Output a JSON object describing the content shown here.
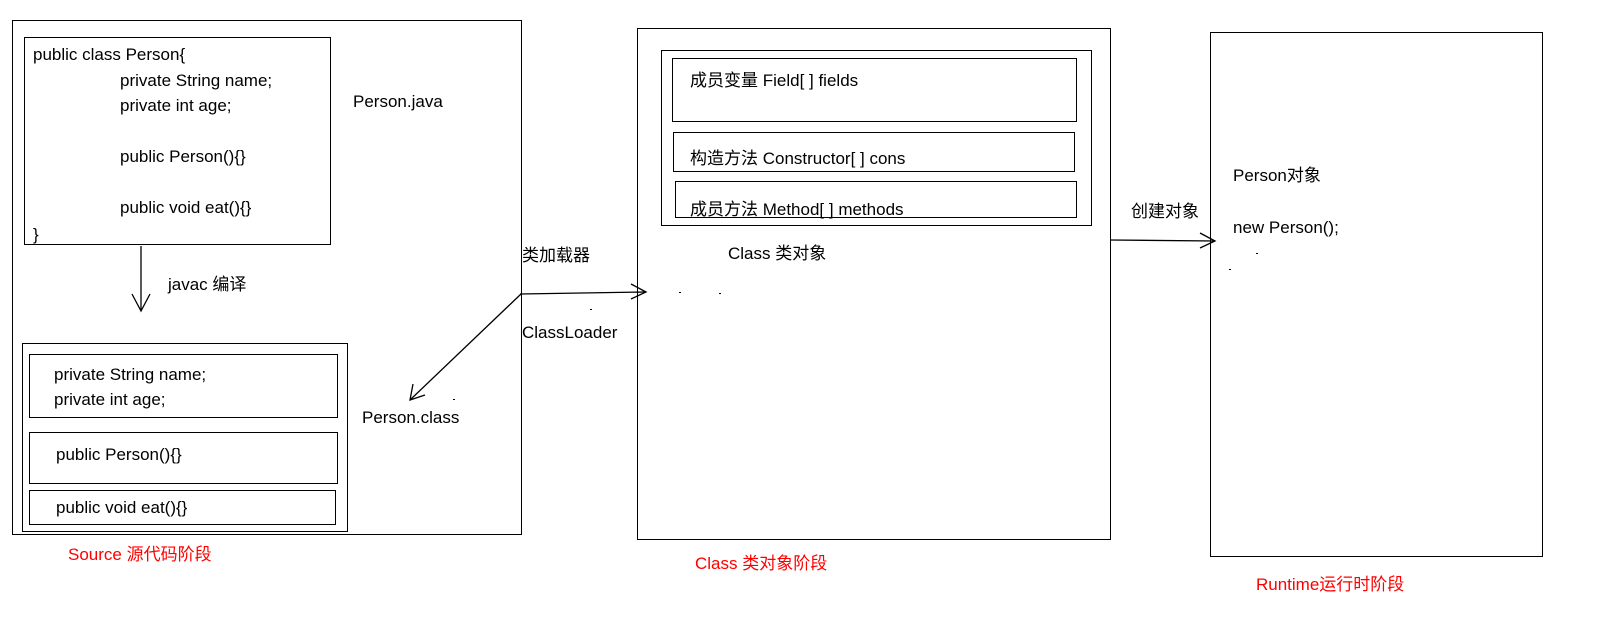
{
  "source_stage": {
    "code_lines": [
      "public class Person{",
      "private String name;",
      "private int age;",
      "public Person(){}",
      "public void eat(){}",
      "}"
    ],
    "file_label": "Person.java",
    "compile_label": "javac 编译",
    "class_file_sections": {
      "fields": [
        "private String name;",
        "private int age;"
      ],
      "constructor": "public Person(){}",
      "method": "public void eat(){}"
    },
    "class_file_label": "Person.class",
    "stage_label": "Source 源代码阶段"
  },
  "classloader": {
    "label_cn": "类加载器",
    "label_en": "ClassLoader"
  },
  "class_stage": {
    "fields_row": "成员变量  Field[ ] fields",
    "constructors_row": "构造方法  Constructor[ ] cons",
    "methods_row": "成员方法 Method[ ] methods",
    "object_label": "Class 类对象",
    "stage_label": "Class 类对象阶段"
  },
  "create_object": {
    "label": "创建对象"
  },
  "runtime_stage": {
    "object_label": "Person对象",
    "new_expr": "new Person();",
    "stage_label": "Runtime运行时阶段"
  },
  "colors": {
    "stage_label": "#ff0000",
    "line": "#000000"
  }
}
